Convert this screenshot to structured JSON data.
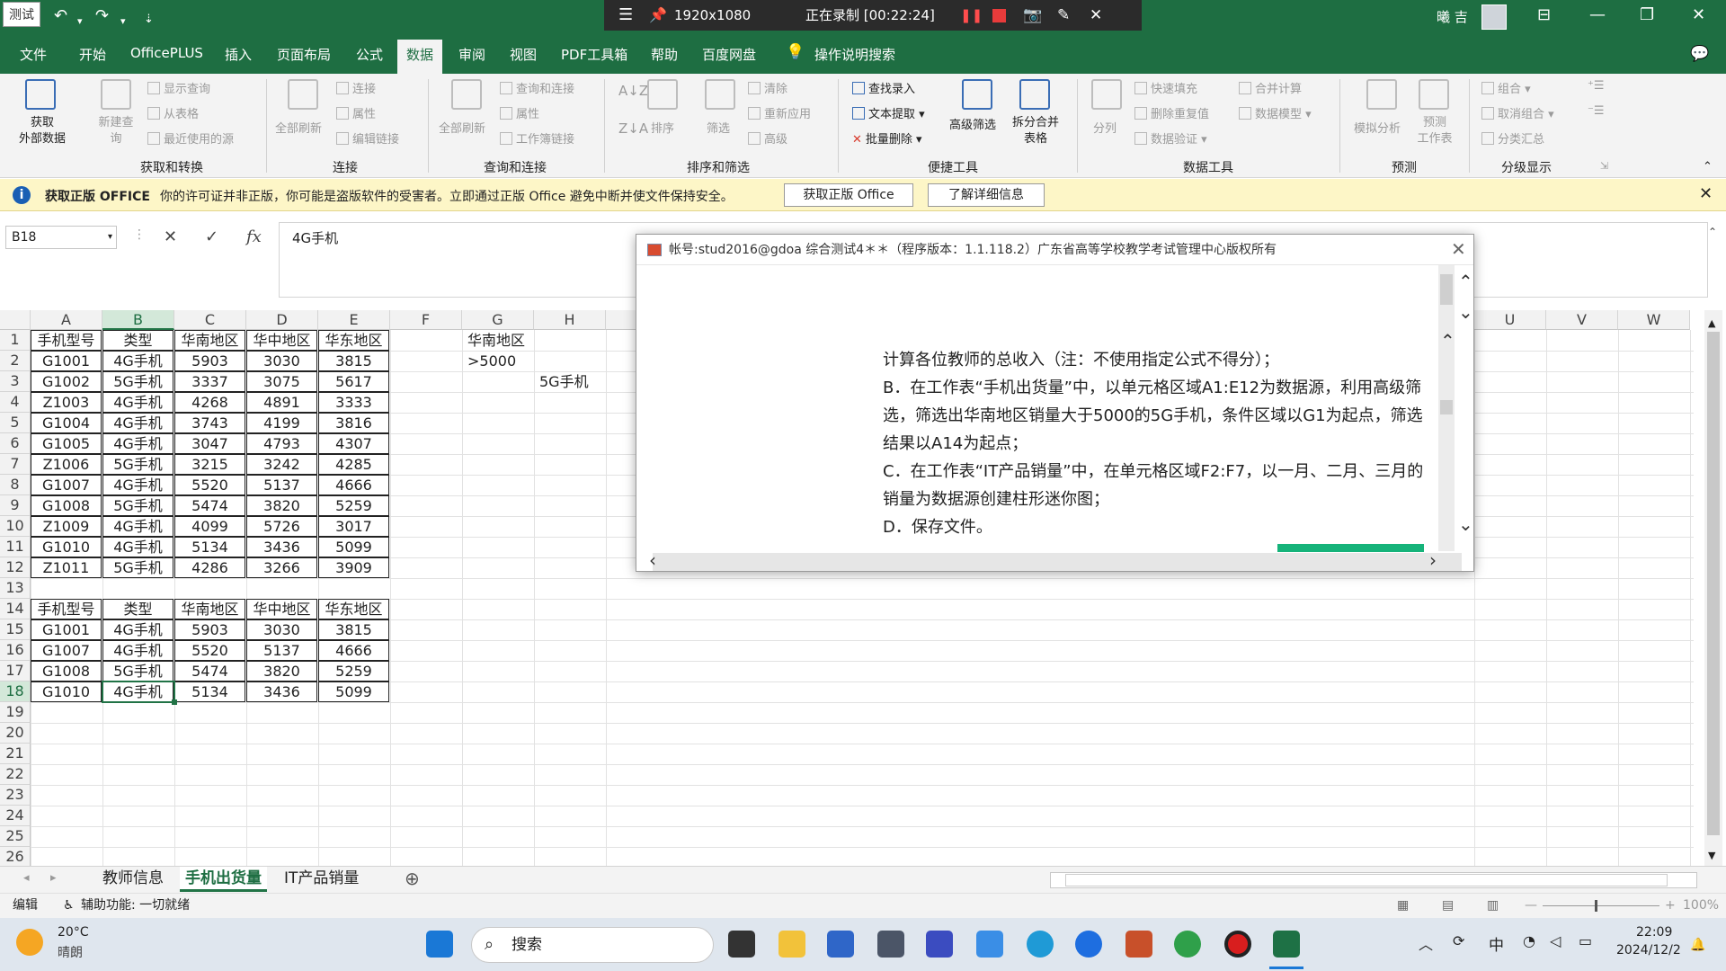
{
  "titlebar": {
    "badge": "测试",
    "recording_size": "1920x1080",
    "recording_status": "正在录制 [00:22:24]",
    "user": "曦 吉"
  },
  "menu": [
    "文件",
    "开始",
    "OfficePLUS",
    "插入",
    "页面布局",
    "公式",
    "数据",
    "审阅",
    "视图",
    "PDF工具箱",
    "帮助",
    "百度网盘"
  ],
  "menu_active": "数据",
  "menu_search": "操作说明搜索",
  "ribbon": {
    "get_external": "获取\n外部数据",
    "new_query": "新建查\n询",
    "show_query": "显示查询",
    "from_table": "从表格",
    "recent_sources": "最近使用的源",
    "group1": "获取和转换",
    "refresh_all": "全部刷新",
    "connections": "连接",
    "properties": "属性",
    "edit_links": "编辑链接",
    "group2": "连接",
    "refresh_all2": "全部刷新",
    "query_conn": "查询和连接",
    "properties2": "属性",
    "workbook_links": "工作簿链接",
    "group3": "查询和连接",
    "sort": "排序",
    "filter": "筛选",
    "clear": "清除",
    "reapply": "重新应用",
    "advanced": "高级",
    "group4": "排序和筛选",
    "lookup": "查找录入",
    "text_extract": "文本提取",
    "batch_delete": "批量删除",
    "adv_filter": "高级筛选",
    "split_merge": "拆分合并\n表格",
    "group5": "便捷工具",
    "split_col": "分列",
    "flash_fill": "快速填充",
    "remove_dup": "删除重复值",
    "data_valid": "数据验证",
    "consolidate": "合并计算",
    "data_model": "数据模型",
    "group6": "数据工具",
    "what_if": "模拟分析",
    "forecast": "预测\n工作表",
    "group7": "预测",
    "group_btn": "组合",
    "ungroup": "取消组合",
    "subtotal": "分类汇总",
    "group8": "分级显示"
  },
  "infobar": {
    "title": "获取正版 OFFICE",
    "message": "你的许可证并非正版，你可能是盗版软件的受害者。立即通过正版 Office 避免中断并使文件保持安全。",
    "btn1": "获取正版 Office",
    "btn2": "了解详细信息"
  },
  "formula_bar": {
    "name_box": "B18",
    "content": "4G手机"
  },
  "columns": [
    "A",
    "B",
    "C",
    "D",
    "E",
    "F",
    "G",
    "H",
    "U",
    "V",
    "W"
  ],
  "rows": [
    "1",
    "2",
    "3",
    "4",
    "5",
    "6",
    "7",
    "8",
    "9",
    "10",
    "11",
    "12",
    "13",
    "14",
    "15",
    "16",
    "17",
    "18",
    "19",
    "20",
    "21",
    "22",
    "23",
    "24",
    "25",
    "26"
  ],
  "table1": {
    "headers": [
      "手机型号",
      "类型",
      "华南地区",
      "华中地区",
      "华东地区"
    ],
    "rows": [
      [
        "G1001",
        "4G手机",
        "5903",
        "3030",
        "3815"
      ],
      [
        "G1002",
        "5G手机",
        "3337",
        "3075",
        "5617"
      ],
      [
        "Z1003",
        "4G手机",
        "4268",
        "4891",
        "3333"
      ],
      [
        "G1004",
        "4G手机",
        "3743",
        "4199",
        "3816"
      ],
      [
        "G1005",
        "4G手机",
        "3047",
        "4793",
        "4307"
      ],
      [
        "Z1006",
        "5G手机",
        "3215",
        "3242",
        "4285"
      ],
      [
        "G1007",
        "4G手机",
        "5520",
        "5137",
        "4666"
      ],
      [
        "G1008",
        "5G手机",
        "5474",
        "3820",
        "5259"
      ],
      [
        "Z1009",
        "4G手机",
        "4099",
        "5726",
        "3017"
      ],
      [
        "G1010",
        "4G手机",
        "5134",
        "3436",
        "5099"
      ],
      [
        "Z1011",
        "5G手机",
        "4286",
        "3266",
        "3909"
      ]
    ]
  },
  "criteria": {
    "g1": "华南地区",
    "g2": ">5000",
    "h3": "5G手机"
  },
  "table2": {
    "headers": [
      "手机型号",
      "类型",
      "华南地区",
      "华中地区",
      "华东地区"
    ],
    "rows": [
      [
        "G1001",
        "4G手机",
        "5903",
        "3030",
        "3815"
      ],
      [
        "G1007",
        "4G手机",
        "5520",
        "5137",
        "4666"
      ],
      [
        "G1008",
        "5G手机",
        "5474",
        "3820",
        "5259"
      ],
      [
        "G1010",
        "4G手机",
        "5134",
        "3436",
        "5099"
      ]
    ]
  },
  "sheets": [
    "教师信息",
    "手机出货量",
    "IT产品销量"
  ],
  "sheet_active": "手机出货量",
  "status": {
    "mode": "编辑",
    "accessibility": "辅助功能: 一切就绪",
    "zoom": "100%"
  },
  "dialog": {
    "title": "帐号:stud2016@gdoa  综合测试4＊＊（程序版本：1.1.118.2）广东省高等学校教学考试管理中心版权所有",
    "lines": [
      "计算各位教师的总收入（注：不使用指定公式不得分）；",
      "B．在工作表“手机出货量”中，以单元格区域A1:E12为数据源，利用高级筛选，筛选出华南地区销量大于5000的5G手机，条件区域以G1为起点，筛选结果以A14为起点；",
      "C．在工作表“IT产品销量”中，在单元格区域F2:F7，以一月、二月、三月的销量为数据源创建柱形迷你图；",
      "D．保存文件。"
    ]
  },
  "taskbar": {
    "weather_temp": "20°C",
    "weather_desc": "晴朗",
    "search": "搜索",
    "ime": "中",
    "time": "22:09",
    "date": "2024/12/2"
  },
  "colors": {
    "excel_green": "#1e6e42",
    "selection": "#217346",
    "infobar_bg": "#fdf6c7",
    "progress": "#16b37a"
  }
}
